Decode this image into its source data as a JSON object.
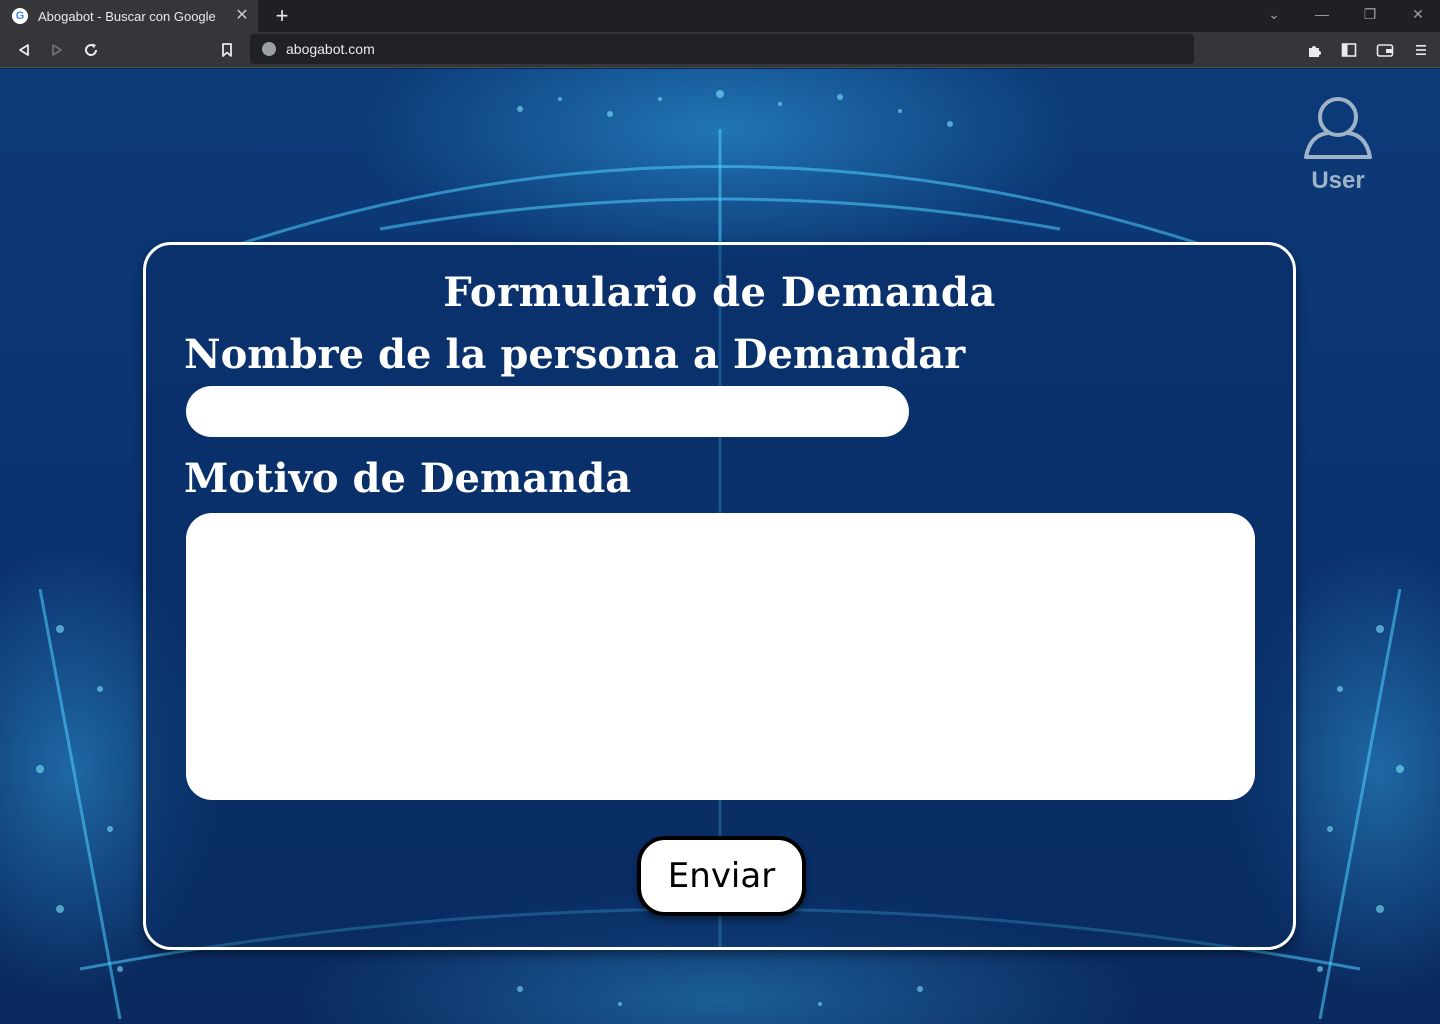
{
  "browser": {
    "tab_title": "Abogabot - Buscar con Google",
    "tab_favicon_letter": "G",
    "url": "abogabot.com",
    "icons": [
      "back-icon",
      "forward-icon",
      "reload-icon",
      "bookmark-icon",
      "site-info-icon",
      "extensions-icon",
      "sidebar-icon",
      "wallet-icon",
      "menu-icon"
    ]
  },
  "user": {
    "label": "User"
  },
  "form": {
    "title": "Formulario de Demanda",
    "name_label": "Nombre de la persona a Demandar",
    "name_value": "",
    "motivo_label": "Motivo de Demanda",
    "motivo_value": "",
    "submit_label": "Enviar"
  },
  "colors": {
    "background": "#0b3270",
    "accent_glow": "#3cbeff",
    "card_border": "#ffffff",
    "button_border": "#000000"
  }
}
